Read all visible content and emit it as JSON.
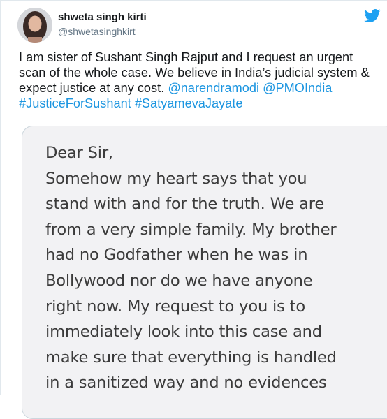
{
  "user": {
    "display_name": "shweta singh kirti",
    "handle": "@shwetasinghkirt",
    "avatar_icon": "avatar-icon"
  },
  "brand": {
    "icon": "twitter-bird-icon",
    "color": "#1da1f2"
  },
  "tweet": {
    "text_lines": [
      "I am sister of Sushant Singh Rajput and I request an urgent",
      "scan of the whole case. We believe in India’s judicial system &",
      "expect justice at any cost. "
    ],
    "mention_1": "@narendramodi",
    "mention_2": "@PMOIndia",
    "hashtag_1": "#JusticeForSushant",
    "hashtag_2": "#SatyamevaJayate",
    "link_color": "#1b95e0"
  },
  "letter": {
    "lines": [
      "Dear Sir,",
      "Somehow my heart says that you",
      "stand with and for the truth. We are",
      "from a very simple family. My brother",
      "had no Godfather when he was in",
      "Bollywood nor do we have anyone",
      "right now. My request to you is to",
      "immediately look into this case and",
      "make sure that everything is handled",
      "in a sanitized way and no evidences"
    ]
  }
}
